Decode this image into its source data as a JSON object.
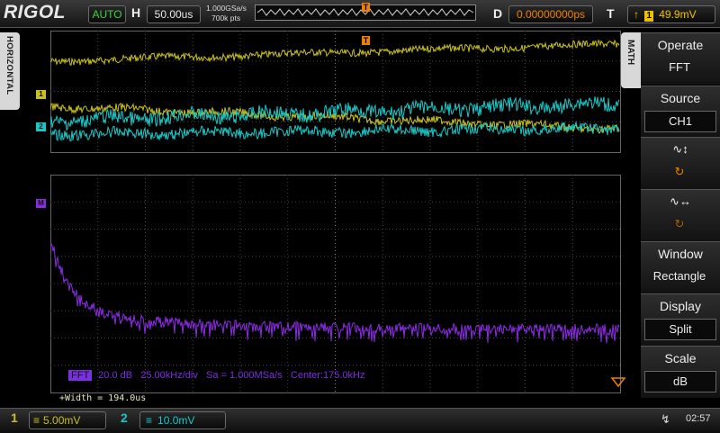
{
  "header": {
    "brand": "RIGOL",
    "run_state": "AUTO",
    "horizontal_label": "H",
    "timebase": "50.00us",
    "sample_rate": "1.000GSa/s",
    "memory_depth": "700k pts",
    "trigger_position_marker": "T",
    "delay_label": "D",
    "delay_value": "0.00000000ps",
    "trigger_label": "T",
    "trigger_channel": "1",
    "trigger_level": "49.9mV"
  },
  "left_tab": {
    "label": "HORIZONTAL"
  },
  "channel_markers": {
    "ch1": "1",
    "ch2": "2",
    "math": "M"
  },
  "fft_info": {
    "tag": "FFT",
    "scale": "20.0 dB",
    "freq_div": "25.00kHz/div",
    "sample_rate": "Sa = 1.000MSa/s",
    "center": "Center:175.0kHz"
  },
  "cursor": {
    "width": "+Width = 194.0us"
  },
  "footer": {
    "ch1_num": "1",
    "ch1_scale": "5.00mV",
    "ch2_num": "2",
    "ch2_scale": "10.0mV",
    "clock": "02:57"
  },
  "menu": {
    "tab": "MATH",
    "items": [
      {
        "title": "Operate",
        "value": "FFT"
      },
      {
        "title": "Source",
        "value": "CH1"
      },
      {
        "title": "Window",
        "value": "Rectangle"
      },
      {
        "title": "Display",
        "value": "Split"
      },
      {
        "title": "Scale",
        "value": "dB"
      }
    ]
  },
  "colors": {
    "ch1": "#c8c020",
    "ch2": "#18c8c8",
    "math": "#8a2be2",
    "trigger": "#f08000",
    "run": "#40d040"
  }
}
